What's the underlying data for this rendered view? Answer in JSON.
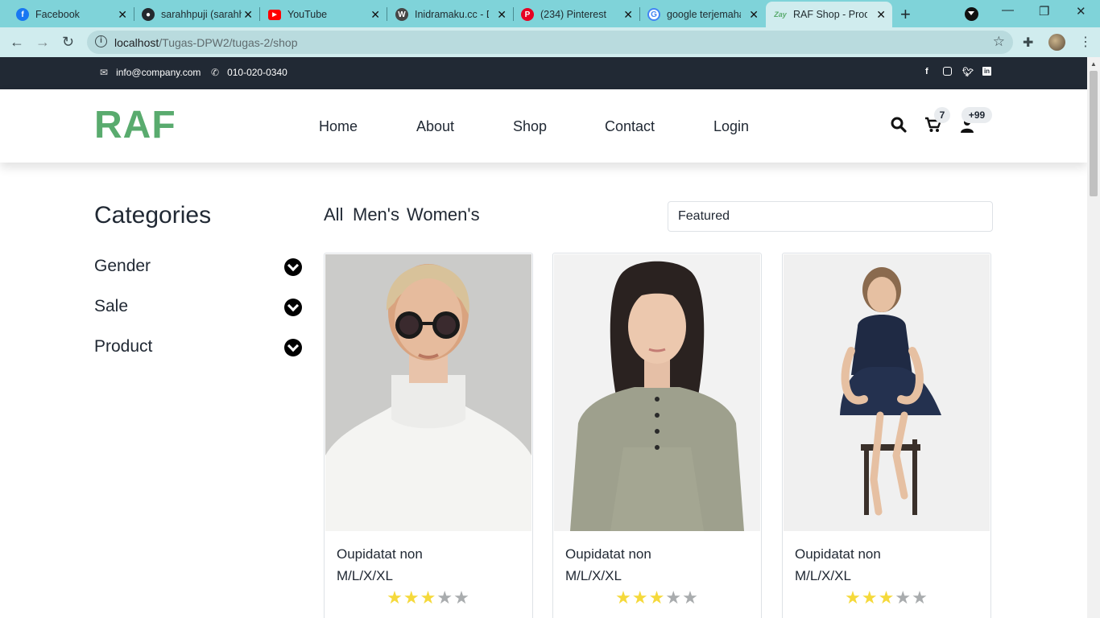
{
  "browser": {
    "tabs": [
      {
        "label": "Facebook",
        "icon": "facebook-icon"
      },
      {
        "label": "sarahhpuji (sarahhpuji)",
        "icon": "github-icon"
      },
      {
        "label": "YouTube",
        "icon": "youtube-icon"
      },
      {
        "label": "Inidramaku.cc - Drama",
        "icon": "wordpress-icon"
      },
      {
        "label": "(234) Pinterest",
        "icon": "pinterest-icon"
      },
      {
        "label": "google terjemahan",
        "icon": "google-icon"
      },
      {
        "label": "RAF Shop - Product",
        "icon": "zay-icon",
        "active": true
      }
    ],
    "url_host": "localhost",
    "url_path": "/Tugas-DPW2/tugas-2/shop"
  },
  "topbar": {
    "email": "info@company.com",
    "phone": "010-020-0340",
    "social": [
      "facebook-icon",
      "instagram-icon",
      "twitter-icon",
      "linkedin-icon"
    ]
  },
  "header": {
    "logo": "RAF",
    "logo_color": "#59ab6e",
    "menu": [
      "Home",
      "About",
      "Shop",
      "Contact",
      "Login"
    ],
    "cart_count": "7",
    "user_count": "+99"
  },
  "sidebar": {
    "title": "Categories",
    "items": [
      "Gender",
      "Sale",
      "Product"
    ]
  },
  "filters": {
    "tabs": [
      "All",
      "Men's",
      "Women's"
    ],
    "sort_selected": "Featured"
  },
  "products": [
    {
      "name": "Oupidatat non",
      "sizes": "M/L/X/XL",
      "rating": 3,
      "max_rating": 5
    },
    {
      "name": "Oupidatat non",
      "sizes": "M/L/X/XL",
      "rating": 3,
      "max_rating": 5
    },
    {
      "name": "Oupidatat non",
      "sizes": "M/L/X/XL",
      "rating": 3,
      "max_rating": 5
    }
  ],
  "colors": {
    "dark": "#212934",
    "accent": "#59ab6e",
    "star_on": "#f5d93b",
    "star_off": "#a9acae"
  }
}
